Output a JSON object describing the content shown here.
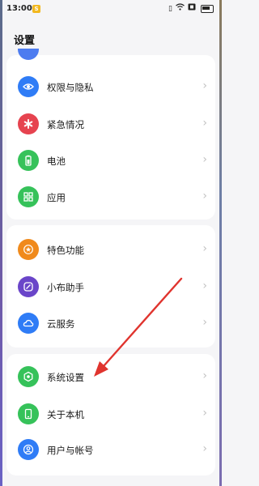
{
  "status_bar": {
    "time": "13:00",
    "notification_badge": "S"
  },
  "header": {
    "title": "设置"
  },
  "groups": [
    {
      "items": [
        {
          "label": "权限与隐私",
          "icon": "privacy-eye-icon",
          "color": "#2f7cf6"
        },
        {
          "label": "紧急情况",
          "icon": "emergency-asterisk-icon",
          "color": "#e6434f"
        },
        {
          "label": "电池",
          "icon": "battery-icon",
          "color": "#36c25a"
        },
        {
          "label": "应用",
          "icon": "apps-grid-icon",
          "color": "#36c25a"
        }
      ]
    },
    {
      "items": [
        {
          "label": "特色功能",
          "icon": "star-icon",
          "color": "#f08a1c"
        },
        {
          "label": "小布助手",
          "icon": "assistant-icon",
          "color": "#6a45c9"
        },
        {
          "label": "云服务",
          "icon": "cloud-icon",
          "color": "#2f7cf6"
        }
      ]
    },
    {
      "items": [
        {
          "label": "系统设置",
          "icon": "system-settings-icon",
          "color": "#36c25a"
        },
        {
          "label": "关于本机",
          "icon": "phone-icon",
          "color": "#36c25a"
        },
        {
          "label": "用户与帐号",
          "icon": "user-icon",
          "color": "#2f7cf6"
        }
      ]
    }
  ],
  "annotation": {
    "color": "#e0342e"
  }
}
